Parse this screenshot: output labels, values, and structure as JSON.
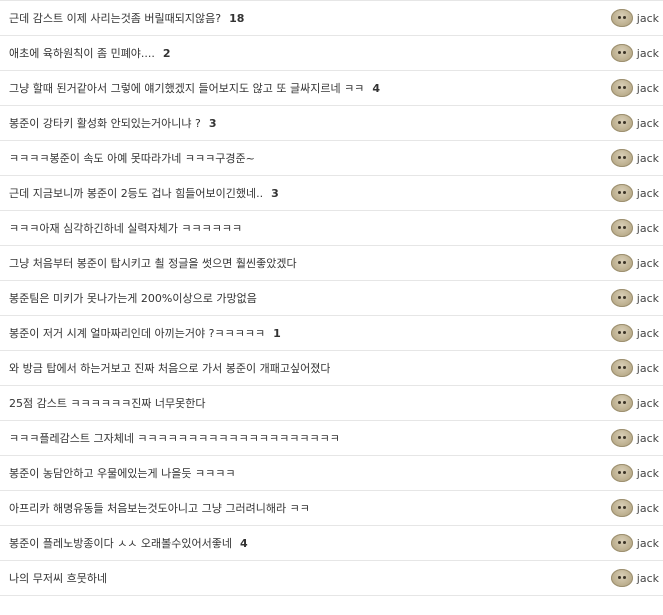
{
  "comments": [
    {
      "title": "근데 감스트 이제 사리는것좀 버릴때되지않음?",
      "count": "18",
      "author": "jack"
    },
    {
      "title": "애초에 육하원칙이 좀 민폐야....",
      "count": "2",
      "author": "jack"
    },
    {
      "title": "그냥 할때 된거같아서 그렇에 얘기했겠지 들어보지도 않고 또 글싸지르네 ㅋㅋ",
      "count": "4",
      "author": "jack"
    },
    {
      "title": "봉준이 강타키 활성화 안되있는거아니냐 ?",
      "count": "3",
      "author": "jack"
    },
    {
      "title": "ㅋㅋㅋㅋ봉준이 속도 아예 못따라가네 ㅋㅋㅋ구경준~",
      "count": "",
      "author": "jack"
    },
    {
      "title": "근데 지금보니까 봉준이 2등도 겁나 힘들어보이긴했네..",
      "count": "3",
      "author": "jack"
    },
    {
      "title": "ㅋㅋㅋ아재 심각하긴하네 실력자체가 ㅋㅋㅋㅋㅋㅋ",
      "count": "",
      "author": "jack"
    },
    {
      "title": "그냥 처음부터 봉준이 탑시키고 쵤 정글을 썻으면 훨씬좋았겠다",
      "count": "",
      "author": "jack"
    },
    {
      "title": "봉준팀은 미키가 못나가는게 200%이상으로 가망없음",
      "count": "",
      "author": "jack"
    },
    {
      "title": "봉준이 저거 시계 얼마짜리인데 아끼는거야 ?ㅋㅋㅋㅋㅋ",
      "count": "1",
      "author": "jack"
    },
    {
      "title": "와 방금 탑에서 하는거보고 진짜 처음으로 가서 봉준이 개패고싶어졌다",
      "count": "",
      "author": "jack"
    },
    {
      "title": "25점 감스트 ㅋㅋㅋㅋㅋㅋ진짜 너무못한다",
      "count": "",
      "author": "jack"
    },
    {
      "title": "ㅋㅋㅋ플레감스트 그자체네 ㅋㅋㅋㅋㅋㅋㅋㅋㅋㅋㅋㅋㅋㅋㅋㅋㅋㅋㅋㅋ",
      "count": "",
      "author": "jack"
    },
    {
      "title": "봉준이 농담안하고 우물에있는게 나을듯 ㅋㅋㅋㅋ",
      "count": "",
      "author": "jack"
    },
    {
      "title": "아프리카 해명유동들 처음보는것도아니고 그냥 그러려니해라 ㅋㅋ",
      "count": "",
      "author": "jack"
    },
    {
      "title": "봉준이 플레노방종이다 ㅅㅅ 오래볼수있어서좋네",
      "count": "4",
      "author": "jack"
    },
    {
      "title": "나의 무저씨 흐뭇하네",
      "count": "",
      "author": "jack"
    }
  ],
  "avatar_icon": "dog-face-avatar-icon"
}
